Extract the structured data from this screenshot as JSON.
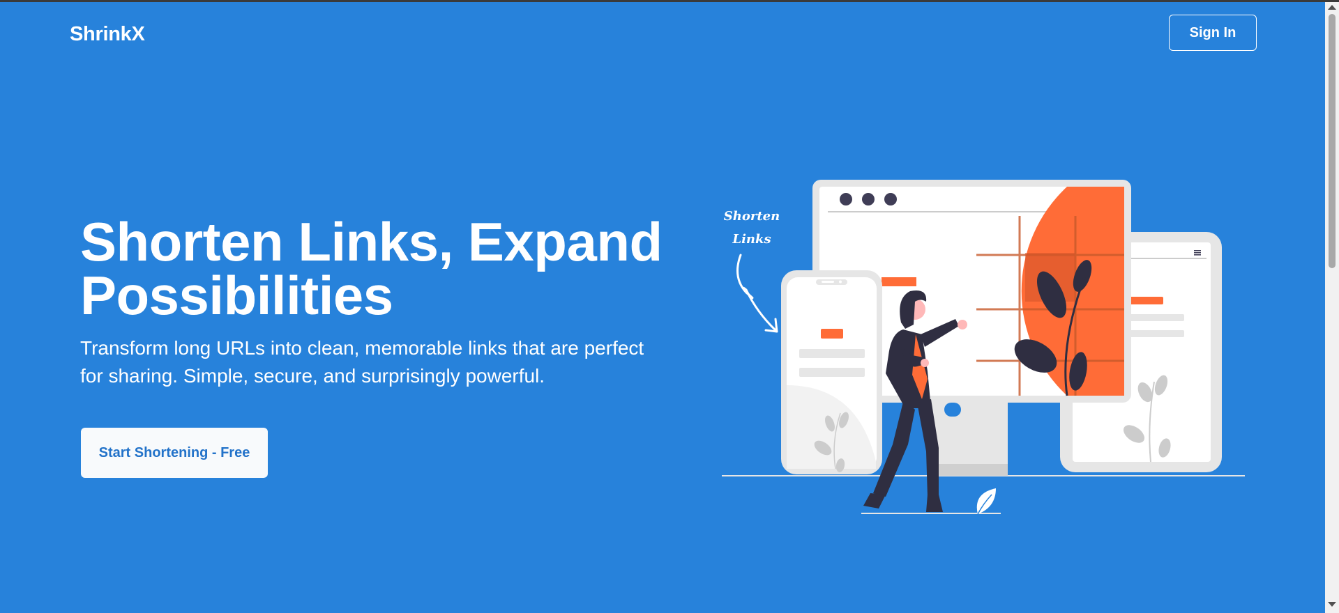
{
  "header": {
    "logo": "ShrinkX",
    "sign_in_label": "Sign In"
  },
  "hero": {
    "title_line1": "Shorten Links, Expand",
    "title_line2": "Possibilities",
    "subtitle_line1": "Transform long URLs into clean, memorable links that are perfect",
    "subtitle_line2": "for sharing. Simple, secure, and surprisingly powerful.",
    "cta_label": "Start Shortening - Free"
  },
  "illustration": {
    "handwritten_line1": "Shorten",
    "handwritten_line2": "Links"
  },
  "colors": {
    "background": "#2782db",
    "accent_orange": "#ff6c37",
    "figure_dark": "#2f2e41",
    "cta_text": "#2272c9"
  }
}
